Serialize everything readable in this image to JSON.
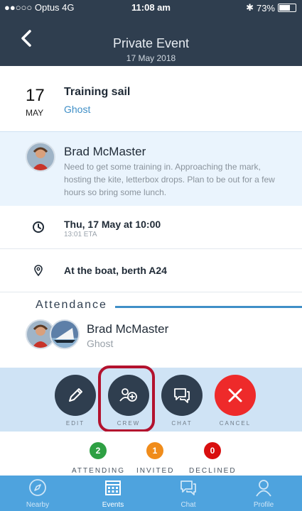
{
  "status_bar": {
    "carrier": "●●○○○ Optus  4G",
    "time": "11:08 am",
    "battery": "73%",
    "battery_level": 0.73
  },
  "nav": {
    "title": "Private Event",
    "subtitle": "17 May 2018"
  },
  "event": {
    "day": "17",
    "month": "MAY",
    "title": "Training sail",
    "boat": "Ghost"
  },
  "organizer": {
    "name": "Brad McMaster",
    "description": "Need to get some training in. Approaching the mark, hosting the kite, letterbox drops. Plan to be out for a few hours so bring some lunch."
  },
  "details": {
    "datetime": "Thu, 17 May at 10:00",
    "eta": "13:01 ETA",
    "location": "At the boat, berth A24"
  },
  "attendance": {
    "title": "Attendance",
    "name": "Brad McMaster",
    "boat": "Ghost"
  },
  "actions": [
    {
      "label": "EDIT",
      "icon": "pencil-icon"
    },
    {
      "label": "CREW",
      "icon": "add-crew-icon"
    },
    {
      "label": "CHAT",
      "icon": "chat-icon"
    },
    {
      "label": "CANCEL",
      "icon": "close-icon"
    }
  ],
  "stats": [
    {
      "label": "ATTENDING",
      "count": "2",
      "color": "#2ea043"
    },
    {
      "label": "INVITED",
      "count": "1",
      "color": "#f08c1b"
    },
    {
      "label": "DECLINED",
      "count": "0",
      "color": "#d90f0f"
    }
  ],
  "tabs": [
    {
      "label": "Nearby",
      "icon": "compass-icon"
    },
    {
      "label": "Events",
      "icon": "calendar-icon"
    },
    {
      "label": "Chat",
      "icon": "chat-icon"
    },
    {
      "label": "Profile",
      "icon": "profile-icon"
    }
  ],
  "colors": {
    "header": "#2f3e4f",
    "accent": "#3f8fc7",
    "tabbar": "#4ea3de",
    "highlight": "#b3122e"
  }
}
